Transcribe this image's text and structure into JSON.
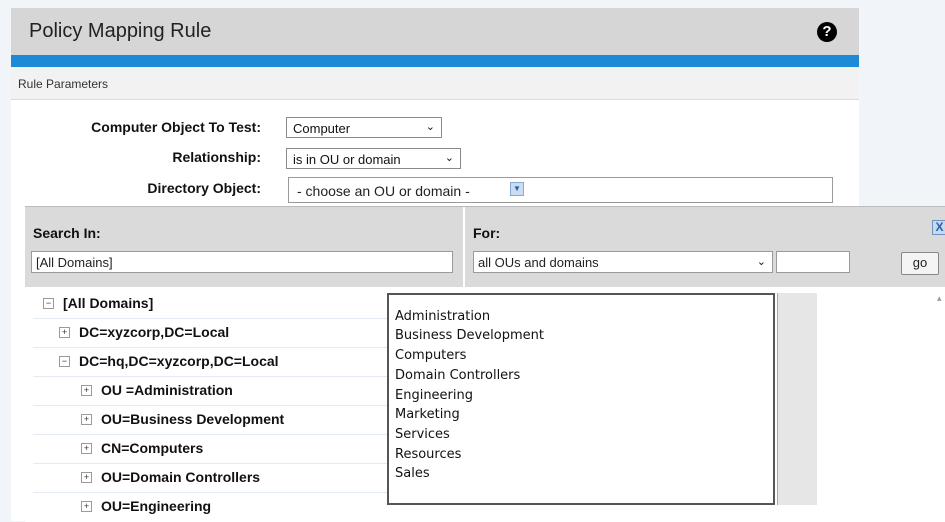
{
  "dialog": {
    "title": "Policy Mapping Rule",
    "help_icon": "?",
    "section_label": "Rule Parameters",
    "params": {
      "computer_label": "Computer Object To Test:",
      "computer_value": "Computer",
      "relationship_label": "Relationship:",
      "relationship_value": "is in OU or domain",
      "directory_label": "Directory Object:",
      "directory_value": "- choose an OU or domain -"
    }
  },
  "popup": {
    "search_label": "Search In:",
    "search_value": "[All Domains]",
    "for_label": "For:",
    "for_value": "all OUs and domains",
    "for_text_value": "",
    "go_label": "go",
    "close_label": "X"
  },
  "tree": [
    {
      "toggle": "−",
      "label": "[All Domains]"
    },
    {
      "toggle": "+",
      "label": "DC=xyzcorp,DC=Local"
    },
    {
      "toggle": "−",
      "label": "DC=hq,DC=xyzcorp,DC=Local"
    },
    {
      "toggle": "+",
      "label": "OU =Administration"
    },
    {
      "toggle": "+",
      "label": "OU=Business Development"
    },
    {
      "toggle": "+",
      "label": "CN=Computers"
    },
    {
      "toggle": "+",
      "label": "OU=Domain Controllers"
    },
    {
      "toggle": "+",
      "label": "OU=Engineering"
    }
  ],
  "results": [
    "Administration",
    "Business Development",
    "Computers",
    "Domain Controllers",
    "Engineering",
    "Marketing",
    "Services",
    "Resources",
    "Sales"
  ],
  "colors": {
    "accent_bar": "#1d8ad7",
    "header_gray": "#d6d6d6"
  },
  "icons": {
    "help": "question-circle-icon",
    "close": "close-icon",
    "chevron": "chevron-down-icon",
    "expand": "plus-box-icon",
    "collapse": "minus-box-icon"
  }
}
